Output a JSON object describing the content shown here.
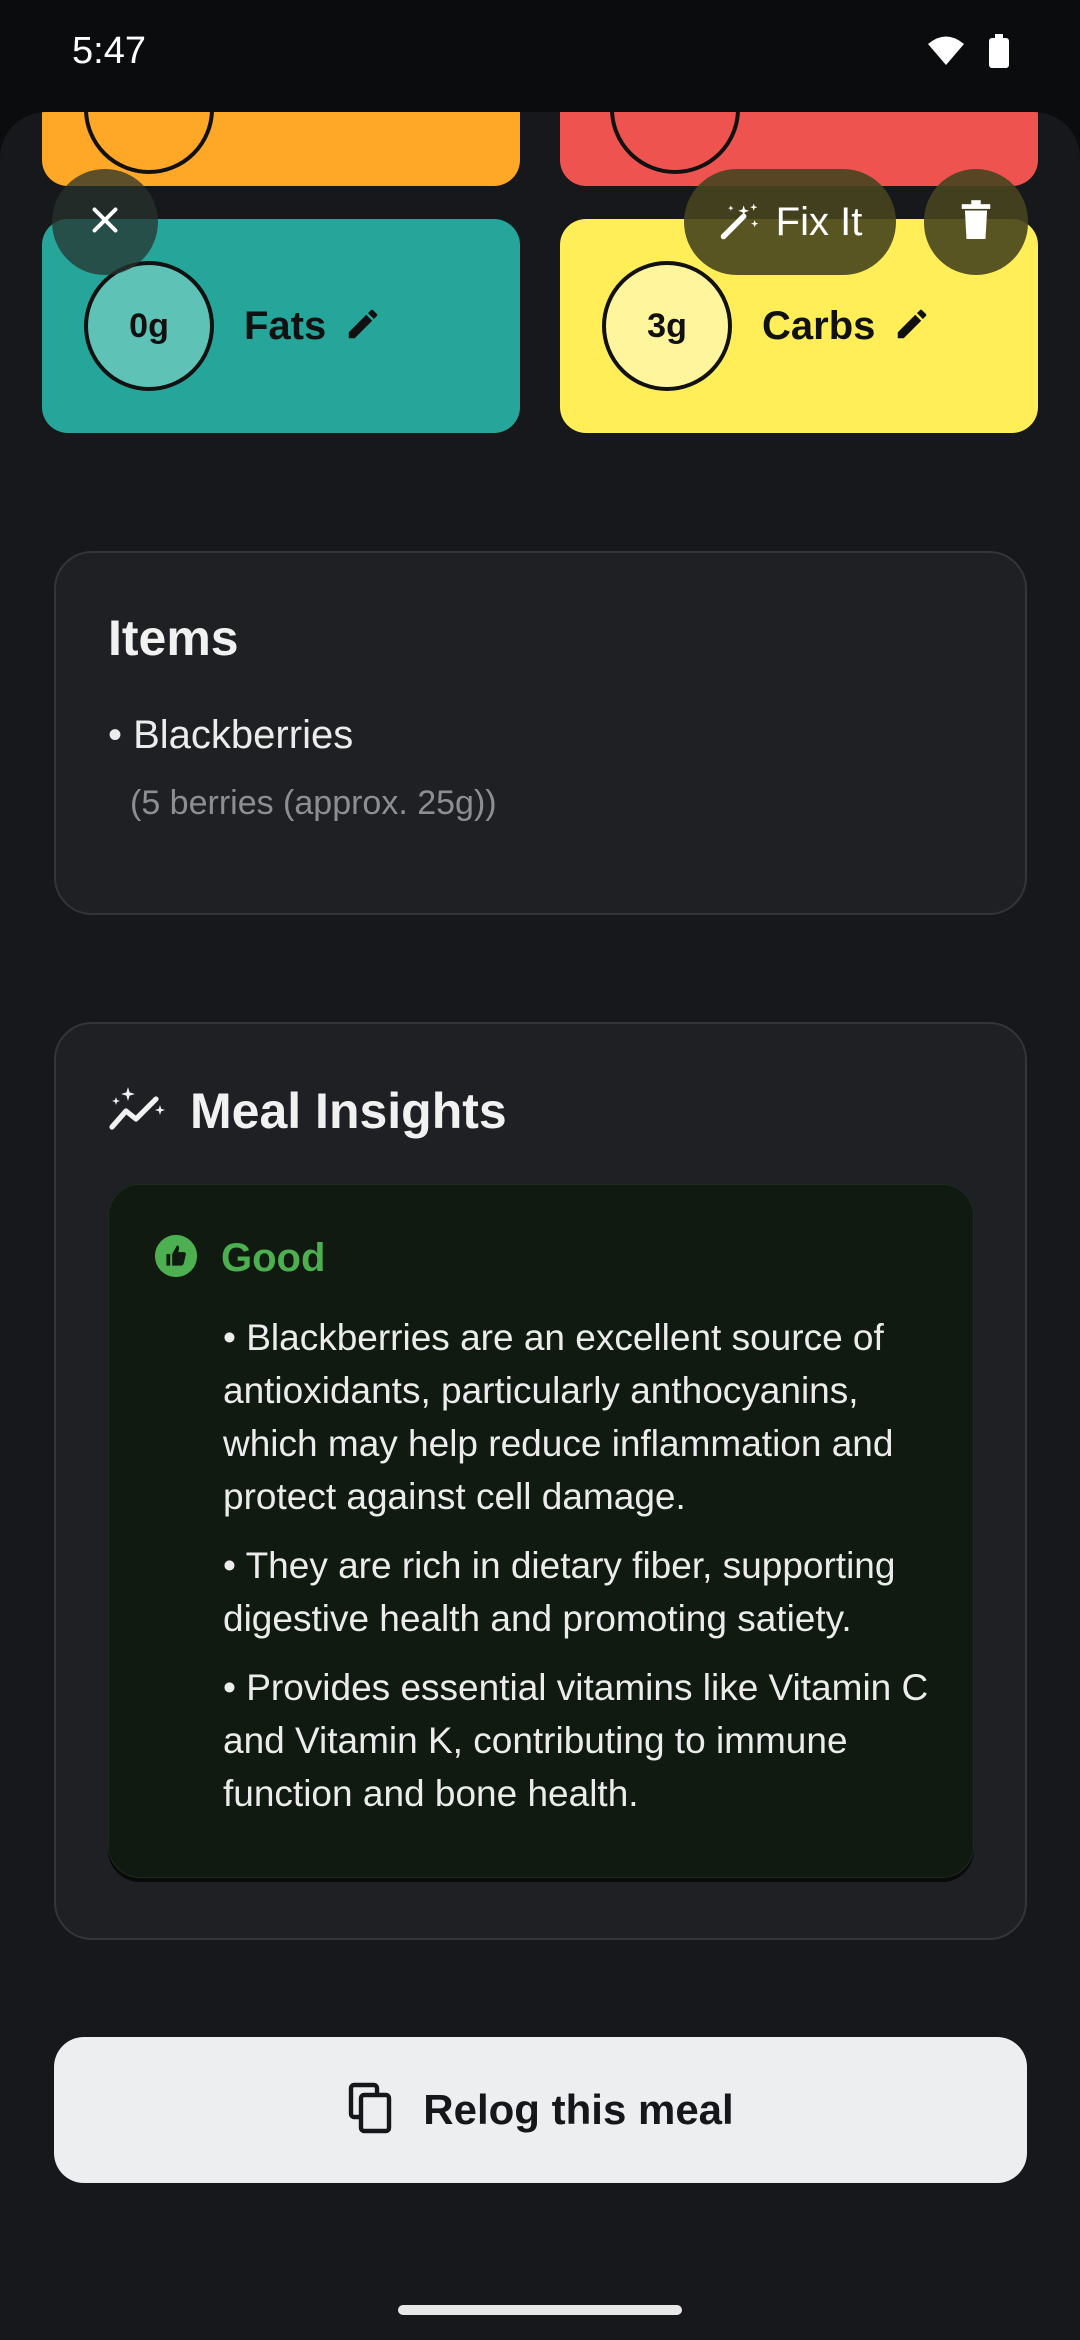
{
  "status_bar": {
    "time": "5:47"
  },
  "macros": {
    "fats": {
      "value": "0g",
      "label": "Fats",
      "color": "#26a69a",
      "circle_color": "#5ec2b7"
    },
    "carbs": {
      "value": "3g",
      "label": "Carbs",
      "color": "#ffee58",
      "circle_color": "#fff59d"
    },
    "top_left_color": "#ffa726",
    "top_right_color": "#ef5350"
  },
  "overlay": {
    "fix_it_label": "Fix It"
  },
  "items_section": {
    "title": "Items",
    "items": [
      {
        "name": "• Blackberries",
        "quantity": "(5 berries (approx. 25g))"
      }
    ]
  },
  "insights_section": {
    "title": "Meal Insights",
    "rating": "Good",
    "rating_color": "#4caf50",
    "points": [
      "• Blackberries are an excellent source of antioxidants, particularly anthocyanins, which may help reduce inflammation and protect against cell damage.",
      "• They are rich in dietary fiber, supporting digestive health and promoting satiety.",
      "• Provides essential vitamins like Vitamin C and Vitamin K, contributing to immune function and bone health."
    ]
  },
  "relog_button": {
    "label": "Relog this meal"
  }
}
